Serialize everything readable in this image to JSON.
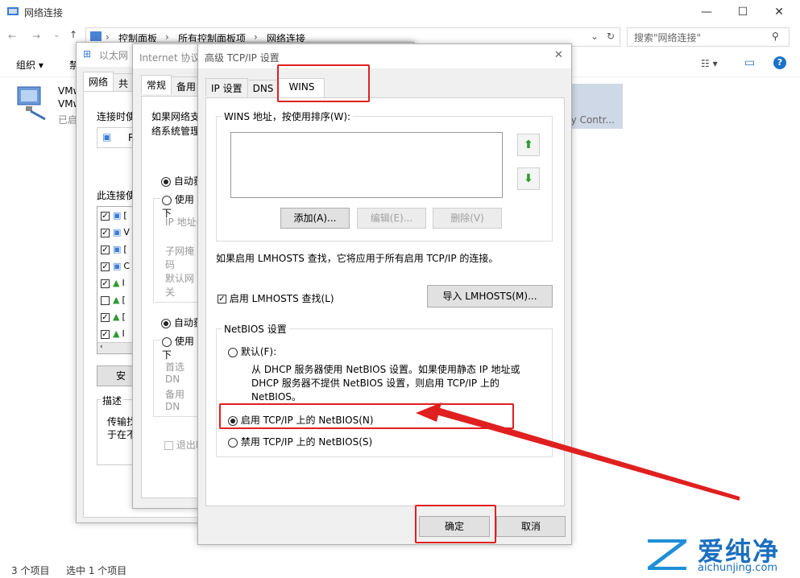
{
  "explorer": {
    "title": "网络连接",
    "breadcrumb": [
      "控制面板",
      "所有控制面板项",
      "网络连接"
    ],
    "search_placeholder": "搜索\"网络连接\"",
    "organize": "组织 ▾",
    "cmd_partial": "禁",
    "adapter_name1": "VMw",
    "adapter_name2": "VMw",
    "adapter_status": "已启",
    "gray_item_text": "ily Contr...",
    "status_items": "3 个项目",
    "status_selected": "选中 1 个项目"
  },
  "eth_dialog": {
    "title": "以太网",
    "tabs": [
      "网络",
      "共"
    ],
    "connect_using": "连接时使",
    "adapter_partial": "R",
    "items_label": "此连接使",
    "items": [
      {
        "checked": true,
        "text": "[",
        "icon": "network-client-icon"
      },
      {
        "checked": true,
        "text": "V",
        "icon": "network-client-icon"
      },
      {
        "checked": true,
        "text": "[",
        "icon": "network-client-icon"
      },
      {
        "checked": true,
        "text": "C",
        "icon": "network-client-icon"
      },
      {
        "checked": true,
        "text": "I",
        "icon": "protocol-icon"
      },
      {
        "checked": false,
        "text": "[",
        "icon": "protocol-icon"
      },
      {
        "checked": true,
        "text": "[",
        "icon": "protocol-icon"
      },
      {
        "checked": true,
        "text": "I",
        "icon": "protocol-icon"
      }
    ],
    "install_btn": "安",
    "desc_label": "描述",
    "desc_text1": "传输找",
    "desc_text2": "于在不"
  },
  "ipv4_dialog": {
    "title": "Internet 协议",
    "tabs": [
      "常规",
      "备用"
    ],
    "intro1": "如果网络支",
    "intro2": "络系统管理",
    "auto_ip": "自动获",
    "manual_ip": "使用下",
    "ip_addr": "IP 地址(",
    "subnet": "子网掩码",
    "gateway": "默认网关",
    "auto_dns": "自动获",
    "manual_dns": "使用下",
    "pref_dns": "首选 DN",
    "alt_dns": "备用 DN",
    "exit_check": "退出时"
  },
  "adv_dialog": {
    "title": "高级 TCP/IP 设置",
    "close": "✕",
    "tabs": [
      "IP 设置",
      "DNS",
      "WINS"
    ],
    "wins_label": "WINS 地址，按使用排序(W):",
    "up_arrow": "⬆",
    "down_arrow": "⬇",
    "add_btn": "添加(A)...",
    "edit_btn": "编辑(E)...",
    "delete_btn": "删除(V)",
    "lmhosts_info": "如果启用 LMHOSTS 查找，它将应用于所有启用 TCP/IP 的连接。",
    "lmhosts_check": "启用 LMHOSTS 查找(L)",
    "lmhosts_checked": true,
    "import_btn": "导入 LMHOSTS(M)...",
    "netbios_legend": "NetBIOS 设置",
    "opt_default": "默认(F):",
    "opt_default_desc1": "从 DHCP 服务器使用 NetBIOS 设置。如果使用静态 IP 地址或",
    "opt_default_desc2": "DHCP 服务器不提供 NetBIOS 设置，则启用 TCP/IP 上的",
    "opt_default_desc3": "NetBIOS。",
    "opt_enable": "启用 TCP/IP 上的 NetBIOS(N)",
    "opt_disable": "禁用 TCP/IP 上的 NetBIOS(S)",
    "selected": "enable",
    "ok_btn": "确定",
    "cancel_btn": "取消"
  },
  "watermark": {
    "brand": "爱纯净",
    "url": "aichunjing.com"
  },
  "colors": {
    "highlight": "#e02020",
    "accent": "#1a73c8"
  }
}
